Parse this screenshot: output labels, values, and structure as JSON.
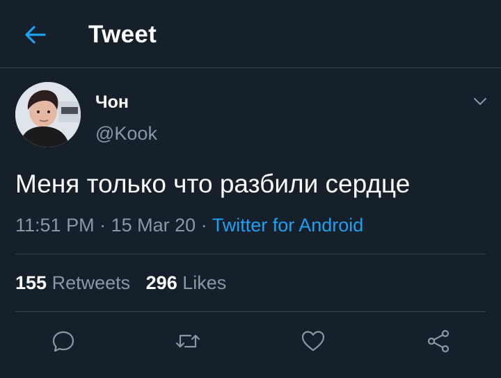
{
  "header": {
    "title": "Tweet",
    "back_icon": "arrow-left-icon"
  },
  "tweet": {
    "author_name": "Чон",
    "author_handle": "@Kook",
    "text": "Меня только что разбили сердце",
    "time": "11:51 PM",
    "date": "15 Mar 20",
    "separator": "·",
    "source": "Twitter for Android",
    "retweets_count": "155",
    "retweets_label": "Retweets",
    "likes_count": "296",
    "likes_label": "Likes"
  },
  "actions": [
    "reply-icon",
    "retweet-icon",
    "like-icon",
    "share-icon"
  ],
  "colors": {
    "background": "#15202b",
    "accent": "#1da1f2",
    "secondary_text": "#8899a6",
    "divider": "#38444d"
  }
}
